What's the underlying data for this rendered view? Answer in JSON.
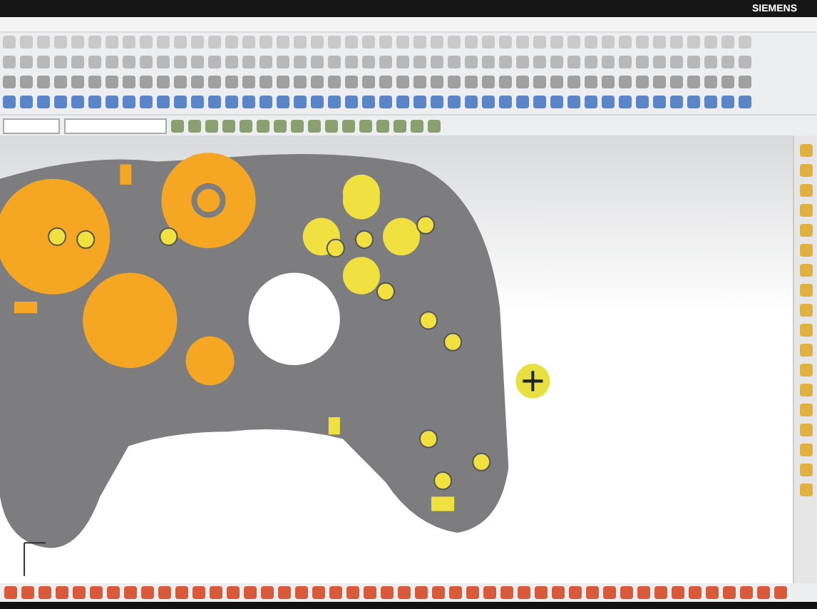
{
  "title_bar": {
    "brand": "SIEMENS"
  }
}
